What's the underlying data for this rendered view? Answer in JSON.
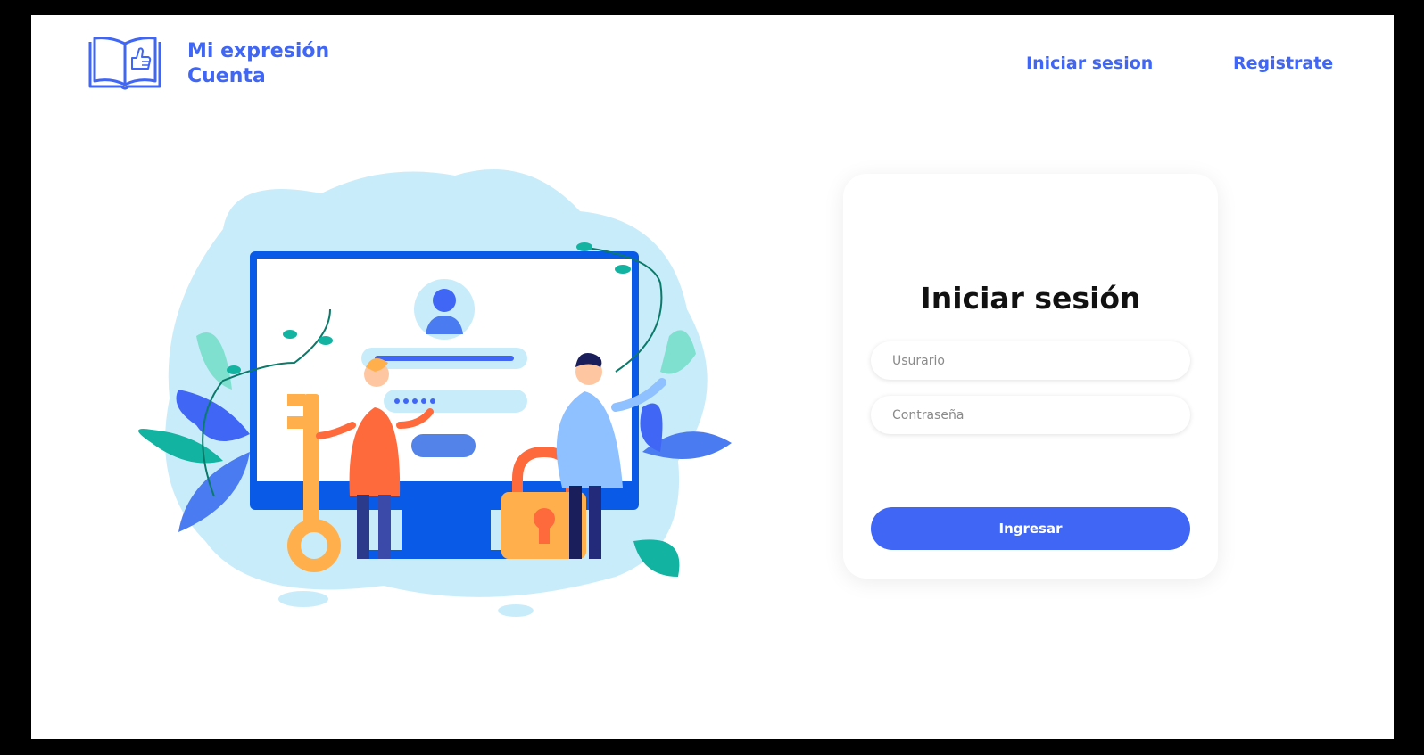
{
  "header": {
    "brand_line1": "Mi expresión",
    "brand_line2": "Cuenta",
    "nav_login": "Iniciar sesion",
    "nav_register": "Registrate"
  },
  "login": {
    "title": "Iniciar sesión",
    "username_placeholder": "Usurario",
    "password_placeholder": "Contraseña",
    "submit_label": "Ingresar"
  },
  "colors": {
    "accent": "#3f66f5",
    "background": "#ffffff",
    "frame": "#000000"
  },
  "icons": {
    "logo": "book-thumbs-up-icon",
    "illustration": "login-security-illustration"
  }
}
